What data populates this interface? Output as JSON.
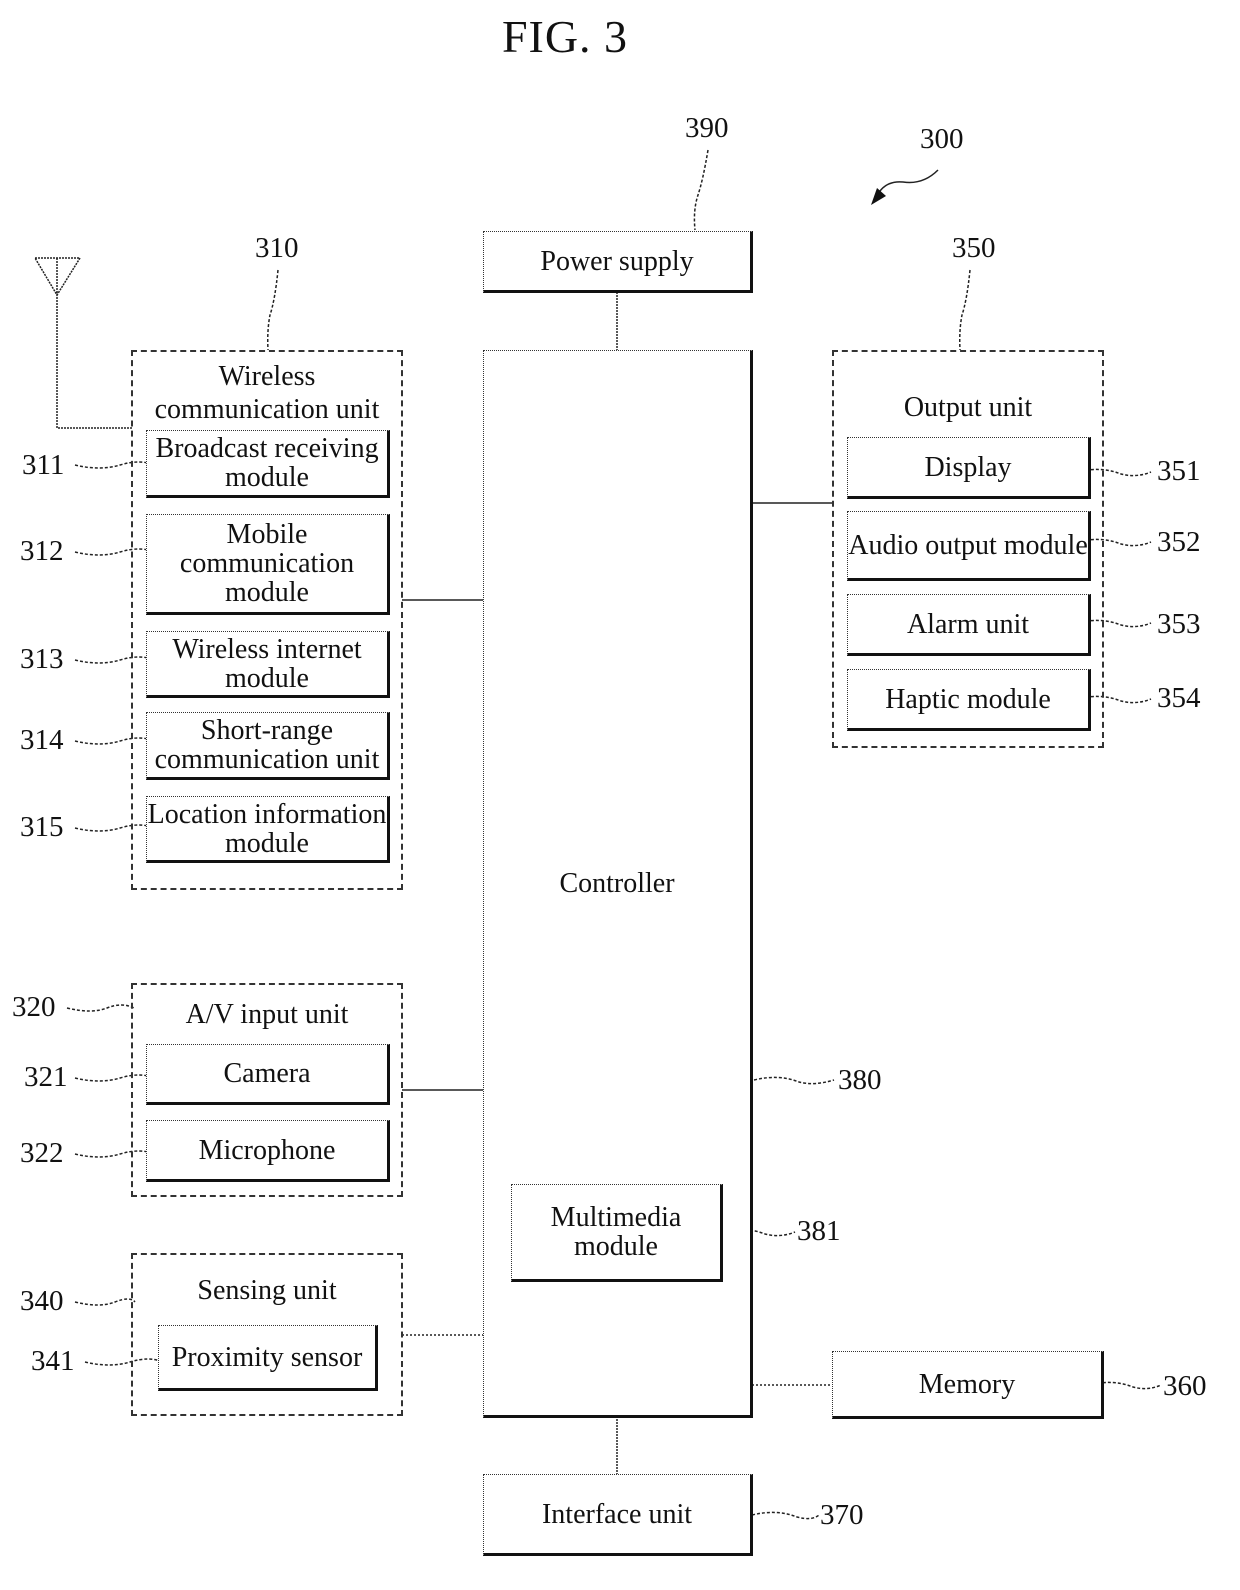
{
  "figure": {
    "title": "FIG. 3",
    "device_ref": "300"
  },
  "power_supply": {
    "ref": "390",
    "label": "Power supply"
  },
  "controller": {
    "ref": "380",
    "label": "Controller",
    "multimedia": {
      "ref": "381",
      "label": "Multimedia module"
    }
  },
  "wireless": {
    "ref": "310",
    "label": "Wireless communication unit",
    "modules": [
      {
        "ref": "311",
        "label": "Broadcast receiving module"
      },
      {
        "ref": "312",
        "label": "Mobile communication module"
      },
      {
        "ref": "313",
        "label": "Wireless internet module"
      },
      {
        "ref": "314",
        "label": "Short-range communication unit"
      },
      {
        "ref": "315",
        "label": "Location information module"
      }
    ]
  },
  "av_input": {
    "ref": "320",
    "label": "A/V input unit",
    "modules": [
      {
        "ref": "321",
        "label": "Camera"
      },
      {
        "ref": "322",
        "label": "Microphone"
      }
    ]
  },
  "sensing": {
    "ref": "340",
    "label": "Sensing unit",
    "modules": [
      {
        "ref": "341",
        "label": "Proximity sensor"
      }
    ]
  },
  "output": {
    "ref": "350",
    "label": "Output unit",
    "modules": [
      {
        "ref": "351",
        "label": "Display"
      },
      {
        "ref": "352",
        "label": "Audio output module"
      },
      {
        "ref": "353",
        "label": "Alarm unit"
      },
      {
        "ref": "354",
        "label": "Haptic module"
      }
    ]
  },
  "memory": {
    "ref": "360",
    "label": "Memory"
  },
  "interface": {
    "ref": "370",
    "label": "Interface unit"
  }
}
